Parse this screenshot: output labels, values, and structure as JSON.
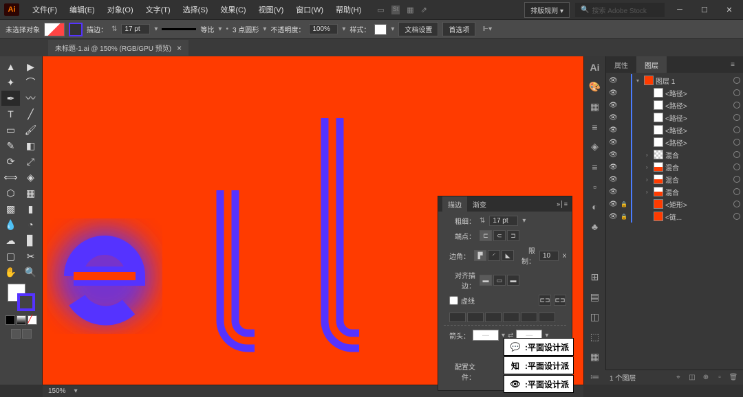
{
  "app": {
    "logo": "Ai"
  },
  "menu": {
    "items": [
      "文件(F)",
      "编辑(E)",
      "对象(O)",
      "文字(T)",
      "选择(S)",
      "效果(C)",
      "视图(V)",
      "窗口(W)",
      "帮助(H)"
    ],
    "workspace": "排版规则",
    "search_placeholder": "搜索 Adobe Stock"
  },
  "control": {
    "selection": "未选择对象",
    "stroke_label": "描边：",
    "stroke_weight": "17 pt",
    "uniform": "等比",
    "brush_opt": "3 点圆形",
    "opacity_label": "不透明度：",
    "opacity": "100%",
    "style_label": "样式：",
    "doc_setup": "文档设置",
    "prefs": "首选项"
  },
  "tab": {
    "title": "未标题-1.ai @ 150% (RGB/GPU 预览)"
  },
  "stroke_panel": {
    "tab1": "描边",
    "tab2": "渐变",
    "weight_label": "粗细：",
    "weight": "17 pt",
    "cap_label": "端点：",
    "corner_label": "边角：",
    "limit_label": "限制：",
    "limit": "10",
    "limit_unit": "x",
    "align_label": "对齐描边：",
    "dashed": "虚线",
    "arrow_label": "箭头：",
    "profile_label": "配置文件："
  },
  "layers_panel": {
    "tab1": "属性",
    "tab2": "图层",
    "rows": [
      {
        "indent": 0,
        "arrow": "▾",
        "thumb": "orange",
        "name": "图层 1"
      },
      {
        "indent": 1,
        "arrow": "",
        "thumb": "white",
        "name": "<路径>"
      },
      {
        "indent": 1,
        "arrow": "",
        "thumb": "white",
        "name": "<路径>"
      },
      {
        "indent": 1,
        "arrow": "",
        "thumb": "white",
        "name": "<路径>"
      },
      {
        "indent": 1,
        "arrow": "",
        "thumb": "white",
        "name": "<路径>"
      },
      {
        "indent": 1,
        "arrow": "",
        "thumb": "white",
        "name": "<路径>"
      },
      {
        "indent": 1,
        "arrow": "›",
        "thumb": "checker",
        "name": "混合"
      },
      {
        "indent": 1,
        "arrow": "›",
        "thumb": "mix",
        "name": "混合"
      },
      {
        "indent": 1,
        "arrow": "›",
        "thumb": "mix",
        "name": "混合"
      },
      {
        "indent": 1,
        "arrow": "›",
        "thumb": "mix",
        "name": "混合"
      },
      {
        "indent": 1,
        "arrow": "",
        "thumb": "orange",
        "name": "<矩形>"
      },
      {
        "indent": 1,
        "arrow": "",
        "thumb": "orange",
        "name": "<链..."
      }
    ],
    "footer_count": "1 个图层"
  },
  "watermarks": {
    "items": [
      ":平面设计派",
      ":平面设计派",
      ":平面设计派"
    ],
    "prefixes": [
      "微",
      "知",
      "博"
    ]
  },
  "status": {
    "zoom": "150%"
  }
}
